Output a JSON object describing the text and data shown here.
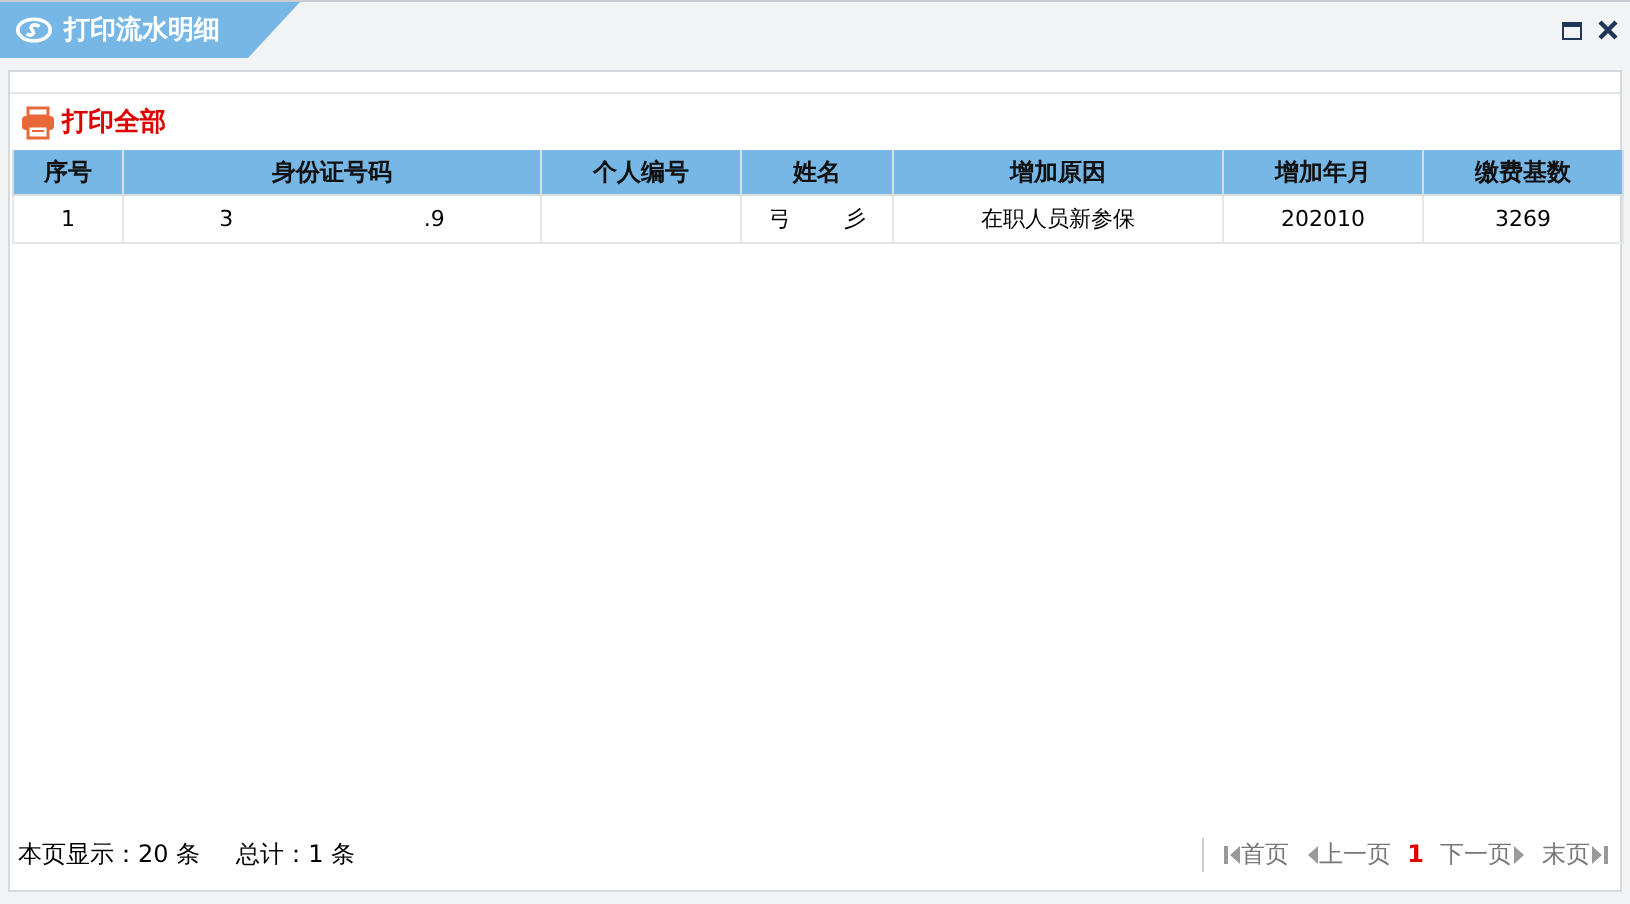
{
  "window": {
    "title": "打印流水明细"
  },
  "toolbar": {
    "print_all": "打印全部"
  },
  "table": {
    "columns": [
      "序号",
      "身份证号码",
      "个人编号",
      "姓名",
      "增加原因",
      "增加年月",
      "缴费基数"
    ],
    "rows": [
      {
        "cells": [
          [
            "1"
          ],
          [
            "3",
            ".9"
          ],
          [],
          [
            "弓",
            "彡"
          ],
          [
            "在职人员新参保"
          ],
          [
            "202010"
          ],
          [
            "3269"
          ]
        ]
      }
    ]
  },
  "footer": {
    "page_size_label": "本页显示：20 条",
    "total_label": "总计：1 条"
  },
  "pager": [
    {
      "kind": "first",
      "label": "首页"
    },
    {
      "kind": "prev",
      "label": "上一页"
    },
    {
      "kind": "page",
      "label": "1"
    },
    {
      "kind": "next",
      "label": "下一页"
    },
    {
      "kind": "last",
      "label": "末页"
    }
  ]
}
